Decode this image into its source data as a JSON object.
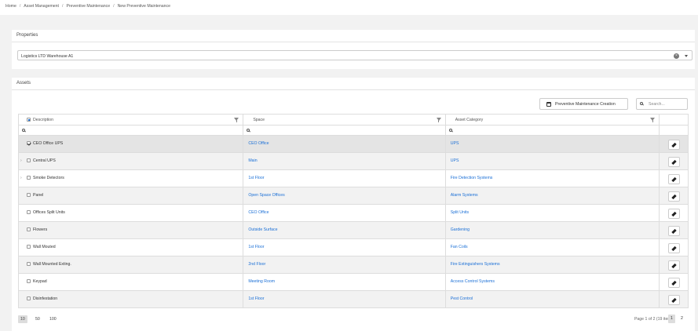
{
  "breadcrumb": [
    "Home",
    "Asset Management",
    "Preventive Maintenance",
    "New Preventive Maintenance"
  ],
  "properties": {
    "title": "Properties",
    "selected": "Logistics LTD Warehouse A1"
  },
  "assets": {
    "title": "Assets",
    "create_button": "Preventive Maintenance Creation",
    "search_placeholder": "Search...",
    "columns": [
      "Description",
      "Space",
      "Asset Category"
    ],
    "rows": [
      {
        "description": "CEO Office UPS",
        "space": "CEO Office",
        "category": "UPS",
        "checked": true,
        "expandable": false
      },
      {
        "description": "Central UPS",
        "space": "Main",
        "category": "UPS",
        "checked": false,
        "expandable": true
      },
      {
        "description": "Smoke Detectors",
        "space": "1st Floor",
        "category": "Fire Detection Systems",
        "checked": false,
        "expandable": true
      },
      {
        "description": "Panel",
        "space": "Open Space Offices",
        "category": "Alarm Systems",
        "checked": false,
        "expandable": false
      },
      {
        "description": "Offices Split Units",
        "space": "CEO Office",
        "category": "Split Units",
        "checked": false,
        "expandable": false
      },
      {
        "description": "Flowers",
        "space": "Outside Surface",
        "category": "Gardening",
        "checked": false,
        "expandable": false
      },
      {
        "description": "Wall Mouted",
        "space": "1st Floor",
        "category": "Fan Coils",
        "checked": false,
        "expandable": false
      },
      {
        "description": "Wall Mounted Exting.",
        "space": "2nd Floor",
        "category": "Fire Extinguishers Systems",
        "checked": false,
        "expandable": false
      },
      {
        "description": "Keypad",
        "space": "Meeting Room",
        "category": "Access Control Systems",
        "checked": false,
        "expandable": false
      },
      {
        "description": "Disinfestation",
        "space": "1st Floor",
        "category": "Pest Control",
        "checked": false,
        "expandable": false
      }
    ]
  },
  "pager": {
    "sizes": [
      "10",
      "50",
      "100"
    ],
    "active_size": "10",
    "info": "Page 1 of 2 (19 items)",
    "pages": [
      "1",
      "2"
    ],
    "active_page": "1"
  },
  "colors": {
    "link": "#1a6fd6"
  }
}
